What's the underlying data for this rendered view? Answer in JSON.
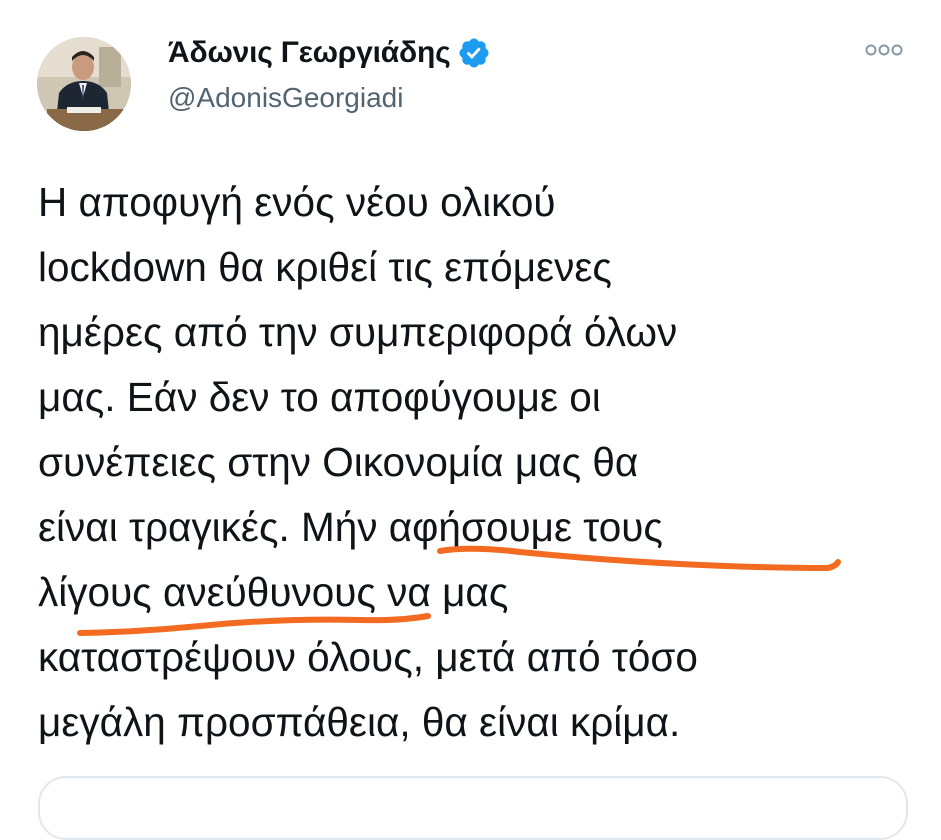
{
  "author": {
    "display_name": "Άδωνις Γεωργιάδης",
    "handle": "@AdonisGeorgiadi",
    "verified": true,
    "avatar_icon": "profile-photo"
  },
  "tweet": {
    "text": "Η αποφυγή ενός νέου ολικού\nlockdown θα κριθεί τις επόμενες\nημέρες από την συμπεριφορά όλων\nμας. Εάν δεν το αποφύγουμε οι\nσυνέπειες στην Οικονομία μας θα\nείναι τραγικές. Μήν αφήσουμε τους\nλίγους ανεύθυνους να μας\nκαταστρέψουν όλους, μετά από τόσο\nμεγάλη προσπάθεια, θα είναι κρίμα."
  },
  "annotation": {
    "color": "#f26b21",
    "underlined_phrases": [
      "Μήν αφήσουμε τους",
      "λίγους ανεύθυνους"
    ]
  },
  "colors": {
    "verified_badge": "#1d9bf0",
    "handle_text": "#536471",
    "body_text": "#0f1419"
  },
  "icons": {
    "more_menu": "more-horizontal-icon",
    "verified": "verified-badge-icon"
  }
}
